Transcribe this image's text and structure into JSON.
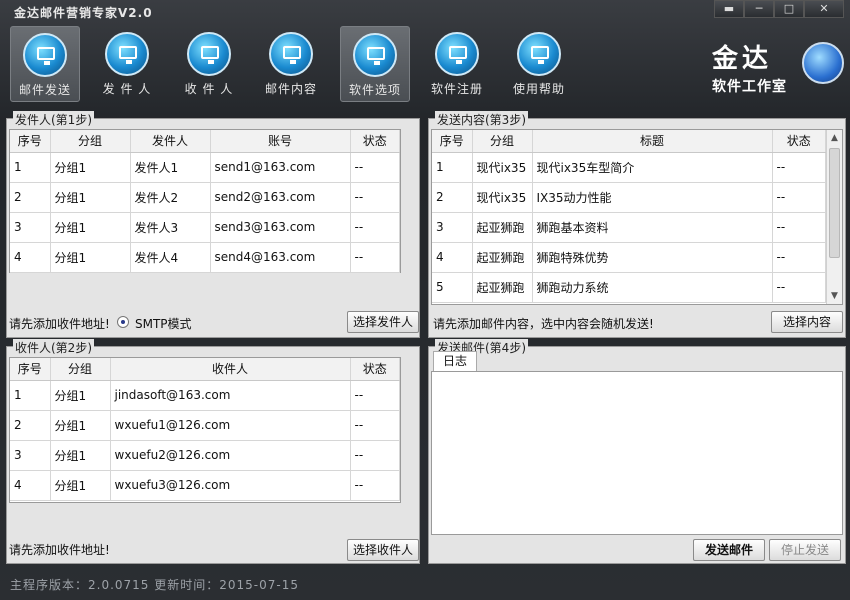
{
  "app": {
    "title": "金达邮件营销专家V2.0"
  },
  "window_controls": {
    "pin": "▬",
    "minimize": "─",
    "maximize": "□",
    "close": "✕"
  },
  "toolbar": [
    {
      "label": "邮件发送",
      "active": true,
      "icon": "monitor-globe-icon"
    },
    {
      "label": "发 件 人",
      "active": false,
      "icon": "monitor-globe-icon"
    },
    {
      "label": "收 件 人",
      "active": false,
      "icon": "monitor-globe-icon"
    },
    {
      "label": "邮件内容",
      "active": false,
      "icon": "monitor-globe-icon"
    },
    {
      "label": "软件选项",
      "active": true,
      "icon": "monitor-globe-icon"
    },
    {
      "label": "软件注册",
      "active": false,
      "icon": "monitor-globe-icon"
    },
    {
      "label": "使用帮助",
      "active": false,
      "icon": "monitor-globe-icon"
    }
  ],
  "logo": {
    "big": "金达",
    "small": "软件工作室"
  },
  "senders": {
    "legend": "发件人(第1步)",
    "columns": [
      "序号",
      "分组",
      "发件人",
      "账号",
      "状态"
    ],
    "rows": [
      [
        "1",
        "分组1",
        "发件人1",
        "send1@163.com",
        "--"
      ],
      [
        "2",
        "分组1",
        "发件人2",
        "send2@163.com",
        "--"
      ],
      [
        "3",
        "分组1",
        "发件人3",
        "send3@163.com",
        "--"
      ],
      [
        "4",
        "分组1",
        "发件人4",
        "send4@163.com",
        "--"
      ]
    ],
    "hint": "请先添加收件地址!",
    "radio_label": "SMTP模式",
    "button": "选择发件人"
  },
  "content": {
    "legend": "发送内容(第3步)",
    "columns": [
      "序号",
      "分组",
      "标题",
      "状态"
    ],
    "rows": [
      [
        "1",
        "现代ix35",
        "现代ix35车型简介",
        "--"
      ],
      [
        "2",
        "现代ix35",
        "IX35动力性能",
        "--"
      ],
      [
        "3",
        "起亚狮跑",
        "狮跑基本资料",
        "--"
      ],
      [
        "4",
        "起亚狮跑",
        "狮跑特殊优势",
        "--"
      ],
      [
        "5",
        "起亚狮跑",
        "狮跑动力系统",
        "--"
      ]
    ],
    "hint": "请先添加邮件内容，选中内容会随机发送!",
    "button": "选择内容"
  },
  "recipients": {
    "legend": "收件人(第2步)",
    "columns": [
      "序号",
      "分组",
      "收件人",
      "状态"
    ],
    "rows": [
      [
        "1",
        "分组1",
        "jindasoft@163.com",
        "--"
      ],
      [
        "2",
        "分组1",
        "wxuefu1@126.com",
        "--"
      ],
      [
        "3",
        "分组1",
        "wxuefu2@126.com",
        "--"
      ],
      [
        "4",
        "分组1",
        "wxuefu3@126.com",
        "--"
      ]
    ],
    "hint": "请先添加收件地址!",
    "button": "选择收件人"
  },
  "send": {
    "legend": "发送邮件(第4步)",
    "tab": "日志",
    "send_button": "发送邮件",
    "stop_button": "停止发送"
  },
  "status": {
    "text": "主程序版本：2.0.0715  更新时间：2015-07-15"
  }
}
